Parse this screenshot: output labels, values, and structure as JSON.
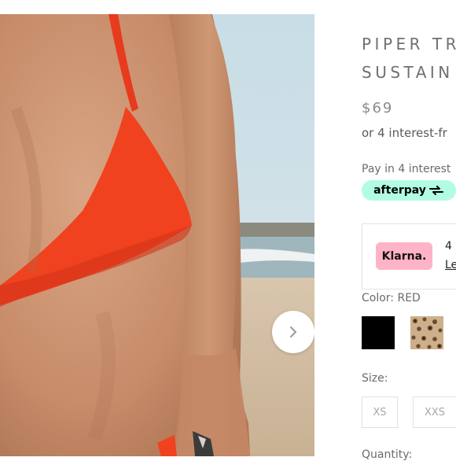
{
  "product": {
    "title_line1": "PIPER TR",
    "title_line2": "SUSTAIN",
    "price": "$69",
    "installments_text": "or 4 interest-fr"
  },
  "afterpay": {
    "pay_in_text": "Pay in 4 interest",
    "logo_text": "afterpay",
    "brand_color": "#b2fce4"
  },
  "klarna": {
    "logo_text": "Klarna.",
    "number_text": "4",
    "link_text": "Le",
    "brand_color": "#ffb3c7"
  },
  "color": {
    "label": "Color: RED",
    "swatches": [
      {
        "name": "black",
        "hex": "#000000"
      },
      {
        "name": "leopard",
        "hex": "#c9a77c"
      }
    ]
  },
  "size": {
    "label": "Size:",
    "options": [
      "XS",
      "XXS"
    ]
  },
  "quantity": {
    "label": "Quantity:"
  },
  "gallery": {
    "next_icon": "chevron-right-icon"
  }
}
